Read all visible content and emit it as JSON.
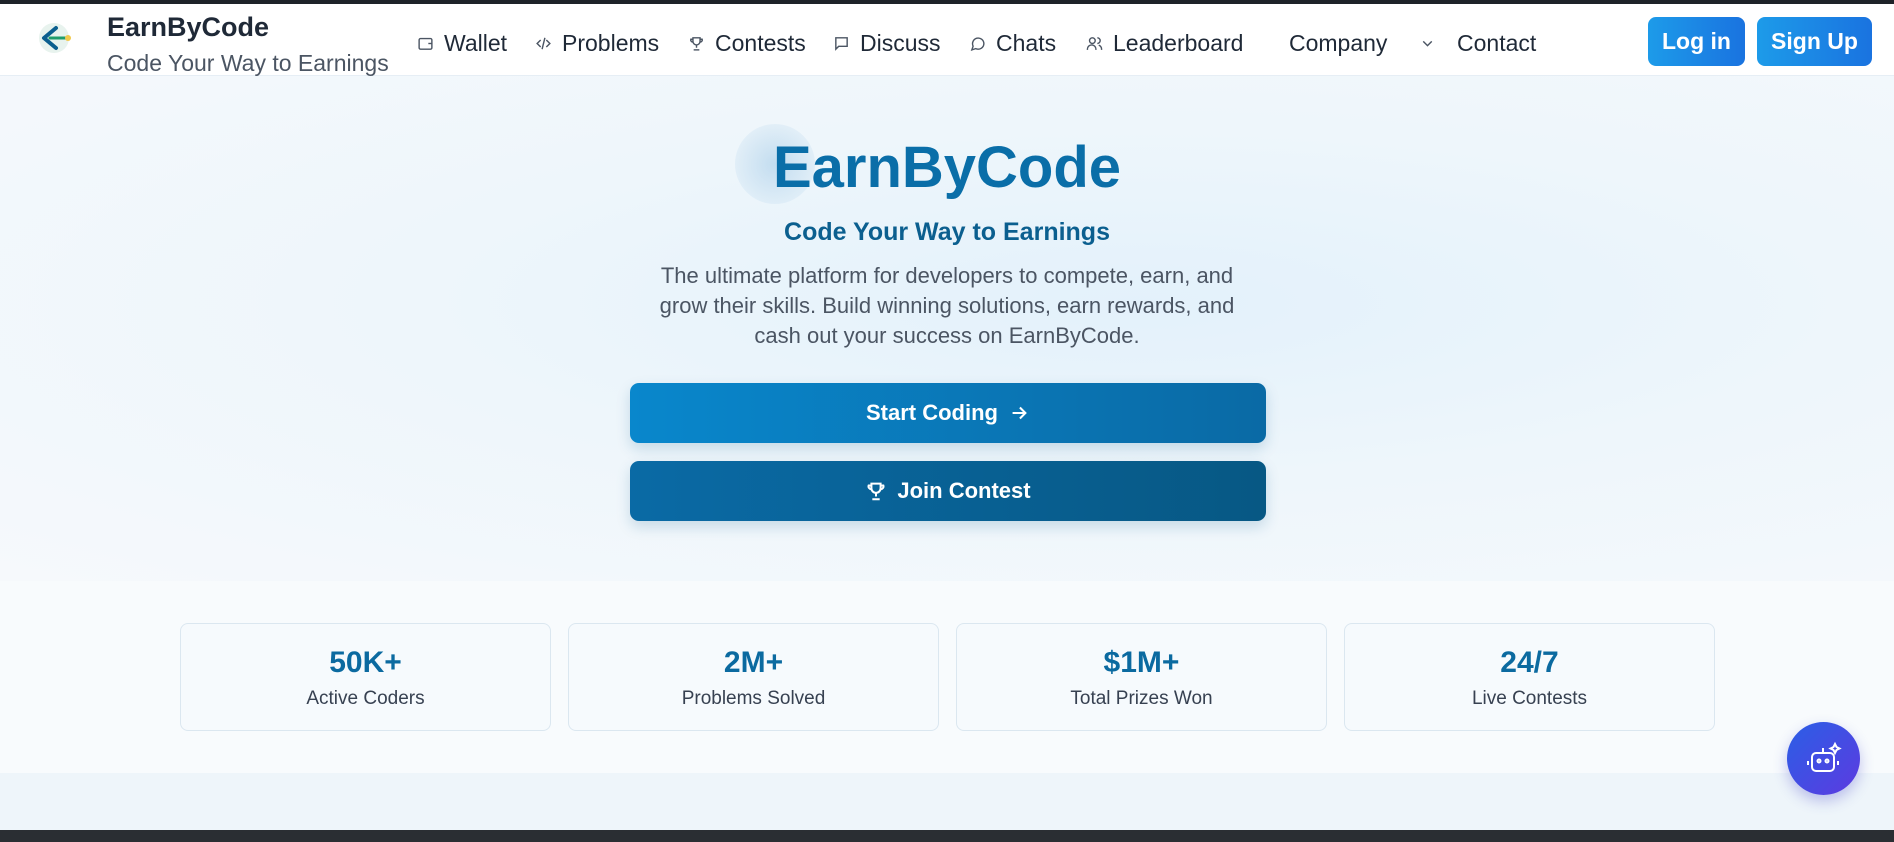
{
  "brand": {
    "title": "EarnByCode",
    "subtitle": "Code Your Way to Earnings"
  },
  "nav": {
    "wallet": "Wallet",
    "problems": "Problems",
    "contests": "Contests",
    "discuss": "Discuss",
    "chats": "Chats",
    "leaderboard": "Leaderboard",
    "company": "Company",
    "contact": "Contact"
  },
  "auth": {
    "login": "Log in",
    "signup": "Sign Up"
  },
  "hero": {
    "title": "EarnByCode",
    "subtitle": "Code Your Way to Earnings",
    "description": "The ultimate platform for developers to compete, earn, and grow their skills. Build winning solutions, earn rewards, and cash out your success on EarnByCode.",
    "start_button": "Start Coding",
    "contest_button": "Join Contest"
  },
  "stats": [
    {
      "value": "50K+",
      "label": "Active Coders"
    },
    {
      "value": "2M+",
      "label": "Problems Solved"
    },
    {
      "value": "$1M+",
      "label": "Total Prizes Won"
    },
    {
      "value": "24/7",
      "label": "Live Contests"
    }
  ],
  "colors": {
    "primary": "#0a6ea8",
    "accent_button": "#1a73e0",
    "bot_button": "#4a4ee4"
  }
}
